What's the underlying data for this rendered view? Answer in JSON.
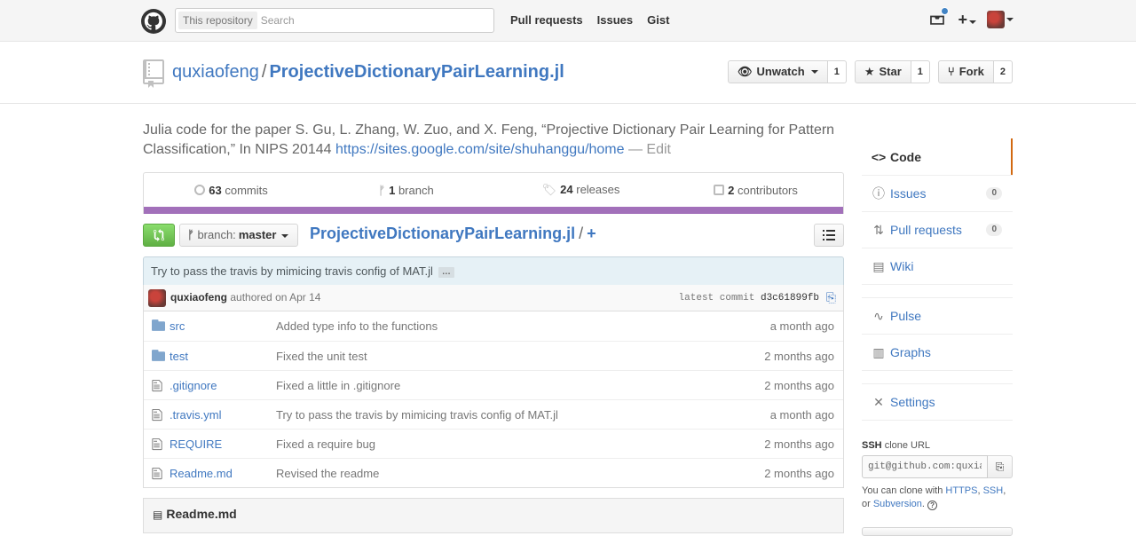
{
  "header": {
    "search_scope": "This repository",
    "search_placeholder": "Search",
    "nav": [
      "Pull requests",
      "Issues",
      "Gist"
    ]
  },
  "repo": {
    "owner": "quxiaofeng",
    "separator": "/",
    "name": "ProjectiveDictionaryPairLearning.jl",
    "watch_label": "Unwatch",
    "watch_count": "1",
    "star_label": "Star",
    "star_count": "1",
    "fork_label": "Fork",
    "fork_count": "2"
  },
  "description": {
    "text": "Julia code for the paper S. Gu, L. Zhang, W. Zuo, and X. Feng, “Projective Dictionary Pair Learning for Pattern Classification,” In NIPS 20144",
    "link": "https://sites.google.com/site/shuhanggu/home",
    "edit": "— Edit"
  },
  "numbers": {
    "commits_count": "63",
    "commits_label": "commits",
    "branches_count": "1",
    "branches_label": "branch",
    "releases_count": "24",
    "releases_label": "releases",
    "contributors_count": "2",
    "contributors_label": "contributors",
    "language_color": "#a270ba"
  },
  "filenav": {
    "branch_label": "branch:",
    "branch_name": "master",
    "repo_crumb": "ProjectiveDictionaryPairLearning.jl",
    "slash": "/",
    "plus": "+"
  },
  "commit": {
    "message": "Try to pass the travis by mimicing travis config of MAT.jl",
    "ellipsis": "…",
    "author": "quxiaofeng",
    "authored": "authored on Apr 14",
    "latest_label": "latest commit",
    "sha": "d3c61899fb"
  },
  "files": [
    {
      "type": "dir",
      "name": "src",
      "message": "Added type info to the functions",
      "age": "a month ago"
    },
    {
      "type": "dir",
      "name": "test",
      "message": "Fixed the unit test",
      "age": "2 months ago"
    },
    {
      "type": "file",
      "name": ".gitignore",
      "message": "Fixed a little in .gitignore",
      "age": "2 months ago"
    },
    {
      "type": "file",
      "name": ".travis.yml",
      "message": "Try to pass the travis by mimicing travis config of MAT.jl",
      "age": "a month ago"
    },
    {
      "type": "file",
      "name": "REQUIRE",
      "message": "Fixed a require bug",
      "age": "2 months ago"
    },
    {
      "type": "file",
      "name": "Readme.md",
      "message": "Revised the readme",
      "age": "2 months ago"
    }
  ],
  "readme": {
    "title": "Readme.md"
  },
  "sidebar": {
    "code": "Code",
    "issues": "Issues",
    "issues_count": "0",
    "pulls": "Pull requests",
    "pulls_count": "0",
    "wiki": "Wiki",
    "pulse": "Pulse",
    "graphs": "Graphs",
    "settings": "Settings"
  },
  "clone": {
    "protocol": "SSH",
    "title_rest": "clone URL",
    "url": "git@github.com:quxiaofeng/ProjectiveDictionaryPairLearning.jl.git",
    "help_prefix": "You can clone with",
    "https": "HTTPS",
    "comma": ",",
    "ssh": "SSH",
    "or": ", or",
    "subversion": "Subversion",
    "period": ".",
    "q": "?"
  }
}
